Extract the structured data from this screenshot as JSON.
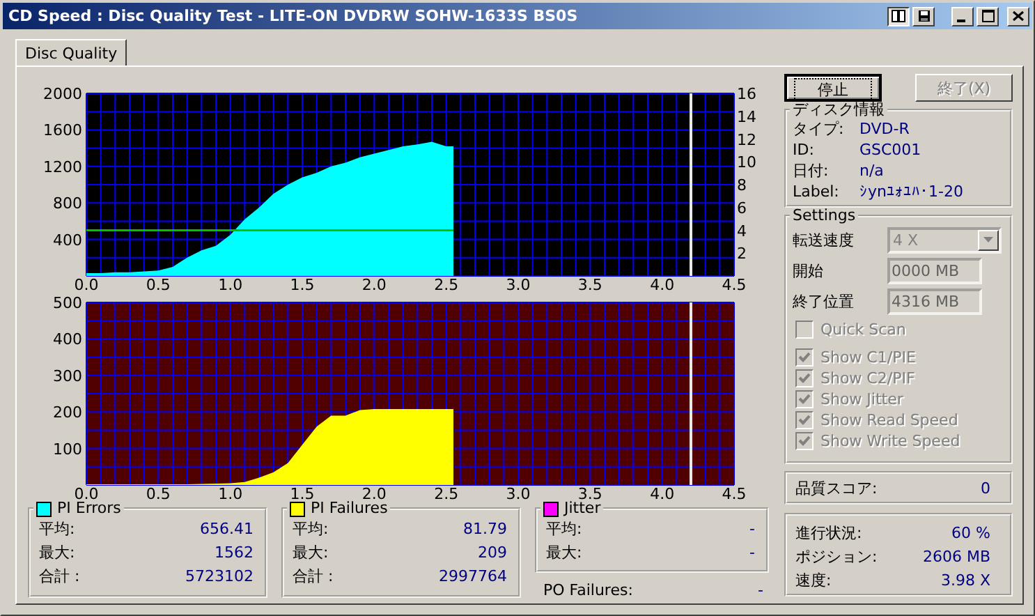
{
  "window": {
    "title": "CD Speed : Disc Quality Test - LITE-ON DVDRW SOHW-1633S BS0S"
  },
  "tabs": [
    {
      "label": "Disc Quality",
      "selected": true
    }
  ],
  "charts": [
    {
      "chart_data": {
        "type": "area",
        "xlim": [
          0,
          4.5
        ],
        "ylim": [
          0,
          2000
        ],
        "y2lim": [
          0,
          16
        ],
        "xticks": [
          {
            "value": 0,
            "label": "0.0"
          },
          0.5,
          {
            "value": 1,
            "label": "1.0"
          },
          1.5,
          {
            "value": 2,
            "label": "2.0"
          },
          2.5,
          {
            "value": 3,
            "label": "3.0"
          },
          3.5,
          {
            "value": 4,
            "label": "4.0"
          },
          4.5
        ],
        "yticks": [
          400,
          800,
          1200,
          1600,
          2000
        ],
        "y2ticks": [
          2,
          4,
          6,
          8,
          10,
          12,
          14,
          16
        ],
        "grid": true,
        "x": [
          0,
          0.1,
          0.2,
          0.3,
          0.4,
          0.5,
          0.6,
          0.7,
          0.8,
          0.9,
          1.0,
          1.1,
          1.2,
          1.3,
          1.4,
          1.5,
          1.6,
          1.7,
          1.8,
          1.9,
          2.0,
          2.1,
          2.2,
          2.3,
          2.4,
          2.5,
          2.55
        ],
        "series": [
          {
            "color": "#00ffff",
            "values": [
              30,
              30,
              40,
              40,
              50,
              60,
              100,
              200,
              280,
              330,
              450,
              620,
              750,
              900,
              1000,
              1080,
              1130,
              1200,
              1240,
              1300,
              1340,
              1380,
              1420,
              1440,
              1470,
              1420,
              1420
            ]
          },
          {
            "color": "#00c000",
            "type": "line",
            "axis": "y2",
            "values": [
              4,
              4,
              4,
              4,
              4,
              4,
              4,
              4,
              4,
              4,
              4,
              4,
              4,
              4,
              4,
              4,
              4,
              4,
              4,
              4,
              4,
              4,
              4,
              4,
              4,
              4,
              4
            ]
          }
        ],
        "ref_lines": [
          {
            "axis": "x",
            "value": 4.2
          }
        ]
      }
    },
    {
      "chart_data": {
        "type": "area",
        "xlim": [
          0,
          4.5
        ],
        "ylim": [
          0,
          500
        ],
        "xticks": [
          {
            "value": 0,
            "label": "0.0"
          },
          0.5,
          {
            "value": 1,
            "label": "1.0"
          },
          1.5,
          {
            "value": 2,
            "label": "2.0"
          },
          2.5,
          {
            "value": 3,
            "label": "3.0"
          },
          3.5,
          {
            "value": 4,
            "label": "4.0"
          },
          4.5
        ],
        "yticks": [
          100,
          200,
          300,
          400,
          500
        ],
        "grid": true,
        "x": [
          0,
          0.1,
          0.2,
          0.3,
          0.4,
          0.5,
          0.6,
          0.7,
          0.8,
          0.9,
          1.0,
          1.1,
          1.2,
          1.3,
          1.4,
          1.5,
          1.6,
          1.7,
          1.8,
          1.9,
          2.0,
          2.1,
          2.2,
          2.3,
          2.4,
          2.5,
          2.55
        ],
        "series": [
          {
            "color": "#ffff00",
            "values": [
              2,
              2,
              2,
              2,
              2,
              2,
              2,
              2,
              3,
              4,
              5,
              8,
              20,
              35,
              60,
              110,
              160,
              190,
              190,
              205,
              208,
              208,
              208,
              208,
              208,
              208,
              208
            ]
          }
        ],
        "ref_lines": [
          {
            "axis": "x",
            "value": 4.2
          }
        ]
      }
    }
  ],
  "buttons": [
    {
      "label": "停止",
      "disabled": false,
      "focused": true
    },
    {
      "label": "終了(X)",
      "disabled": true,
      "focused": false
    }
  ],
  "disc_info": {
    "title": "ディスク情報",
    "rows": [
      {
        "label": "タイプ:",
        "value": "DVD-R"
      },
      {
        "label": "ID:",
        "value": "GSC001"
      },
      {
        "label": "日付:",
        "value": "n/a"
      },
      {
        "label": "Label:",
        "value": "ｼynﾕｫﾕﾊ･1-20"
      }
    ]
  },
  "settings": {
    "title": "Settings",
    "speed": {
      "label": "転送速度",
      "value": "4 X",
      "disabled": true
    },
    "fields": [
      {
        "label": "開始",
        "value": "0000 MB",
        "disabled": true
      },
      {
        "label": "終了位置",
        "value": "4316 MB",
        "disabled": true
      }
    ],
    "options": [
      {
        "label": "Quick Scan",
        "checked": false,
        "disabled": true
      },
      {
        "label": "Show C1/PIE",
        "checked": true,
        "disabled": true
      },
      {
        "label": "Show C2/PIF",
        "checked": true,
        "disabled": true
      },
      {
        "label": "Show Jitter",
        "checked": true,
        "disabled": true
      },
      {
        "label": "Show Read Speed",
        "checked": true,
        "disabled": true
      },
      {
        "label": "Show Write Speed",
        "checked": true,
        "disabled": true
      }
    ]
  },
  "quality_score": {
    "label": "品質スコア:",
    "value": "0"
  },
  "progress": [
    {
      "label": "進行状況:",
      "value": "60 %"
    },
    {
      "label": "ポジション:",
      "value": "2606 MB"
    },
    {
      "label": "速度:",
      "value": "3.98 X"
    }
  ],
  "stats": [
    {
      "title": "PI Errors",
      "color": "#00ffff",
      "rows": [
        {
          "label": "平均:",
          "value": "656.41"
        },
        {
          "label": "最大:",
          "value": "1562"
        },
        {
          "label": "合計 :",
          "value": "5723102"
        }
      ]
    },
    {
      "title": "PI Failures",
      "color": "#ffff00",
      "rows": [
        {
          "label": "平均:",
          "value": "81.79"
        },
        {
          "label": "最大:",
          "value": "209"
        },
        {
          "label": "合計 :",
          "value": "2997764"
        }
      ]
    },
    {
      "title": "Jitter",
      "color": "#ff00ff",
      "rows": [
        {
          "label": "平均:",
          "value": "-"
        },
        {
          "label": "最大:",
          "value": "-"
        }
      ]
    }
  ],
  "po_failures": {
    "label": "PO Failures:",
    "value": "-"
  }
}
